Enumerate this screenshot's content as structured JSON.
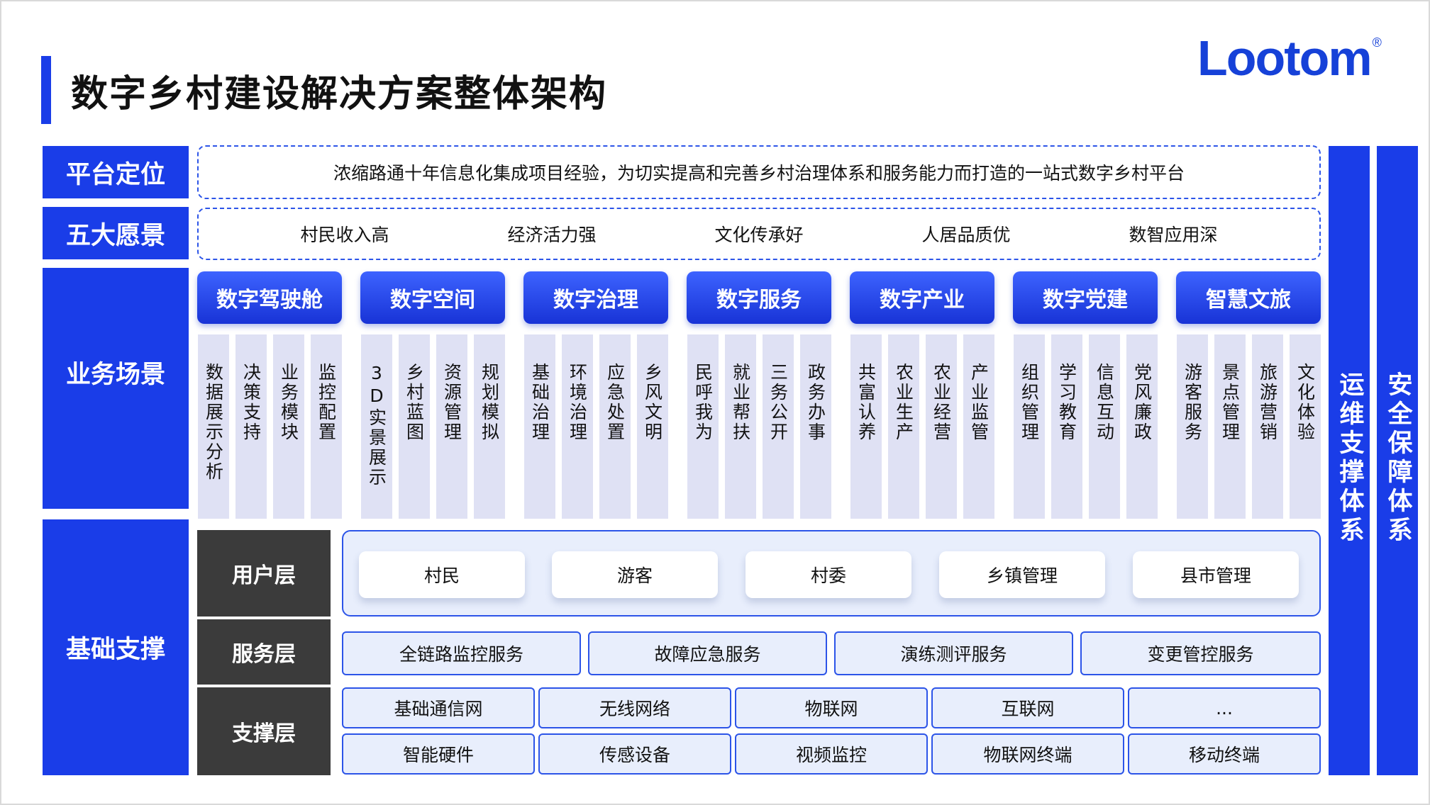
{
  "title": "数字乡村建设解决方案整体架构",
  "logo": {
    "text": "Lootom",
    "mark": "®"
  },
  "labels": {
    "positioning": "平台定位",
    "vision": "五大愿景",
    "scenarios": "业务场景",
    "foundation": "基础支撑"
  },
  "positioning_text": "浓缩路通十年信息化集成项目经验，为切实提高和完善乡村治理体系和服务能力而打造的一站式数字乡村平台",
  "visions": [
    "村民收入高",
    "经济活力强",
    "文化传承好",
    "人居品质优",
    "数智应用深"
  ],
  "categories": [
    {
      "name": "数字驾驶舱",
      "items": [
        "数据展示分析",
        "决策支持",
        "业务模块",
        "监控配置"
      ]
    },
    {
      "name": "数字空间",
      "items": [
        "3D实景展示",
        "乡村蓝图",
        "资源管理",
        "规划模拟"
      ]
    },
    {
      "name": "数字治理",
      "items": [
        "基础治理",
        "环境治理",
        "应急处置",
        "乡风文明"
      ]
    },
    {
      "name": "数字服务",
      "items": [
        "民呼我为",
        "就业帮扶",
        "三务公开",
        "政务办事"
      ]
    },
    {
      "name": "数字产业",
      "items": [
        "共富认养",
        "农业生产",
        "农业经营",
        "产业监管"
      ]
    },
    {
      "name": "数字党建",
      "items": [
        "组织管理",
        "学习教育",
        "信息互动",
        "党风廉政"
      ]
    },
    {
      "name": "智慧文旅",
      "items": [
        "游客服务",
        "景点管理",
        "旅游营销",
        "文化体验"
      ]
    }
  ],
  "layers": {
    "user": {
      "label": "用户层",
      "items": [
        "村民",
        "游客",
        "村委",
        "乡镇管理",
        "县市管理"
      ]
    },
    "service": {
      "label": "服务层",
      "items": [
        "全链路监控服务",
        "故障应急服务",
        "演练测评服务",
        "变更管控服务"
      ]
    },
    "support": {
      "label": "支撑层",
      "row1": [
        "基础通信网",
        "无线网络",
        "物联网",
        "互联网",
        "..."
      ],
      "row2": [
        "智能硬件",
        "传感设备",
        "视频监控",
        "物联网终端",
        "移动终端"
      ]
    }
  },
  "side_columns": [
    "运维支撑体系",
    "安全保障体系"
  ]
}
